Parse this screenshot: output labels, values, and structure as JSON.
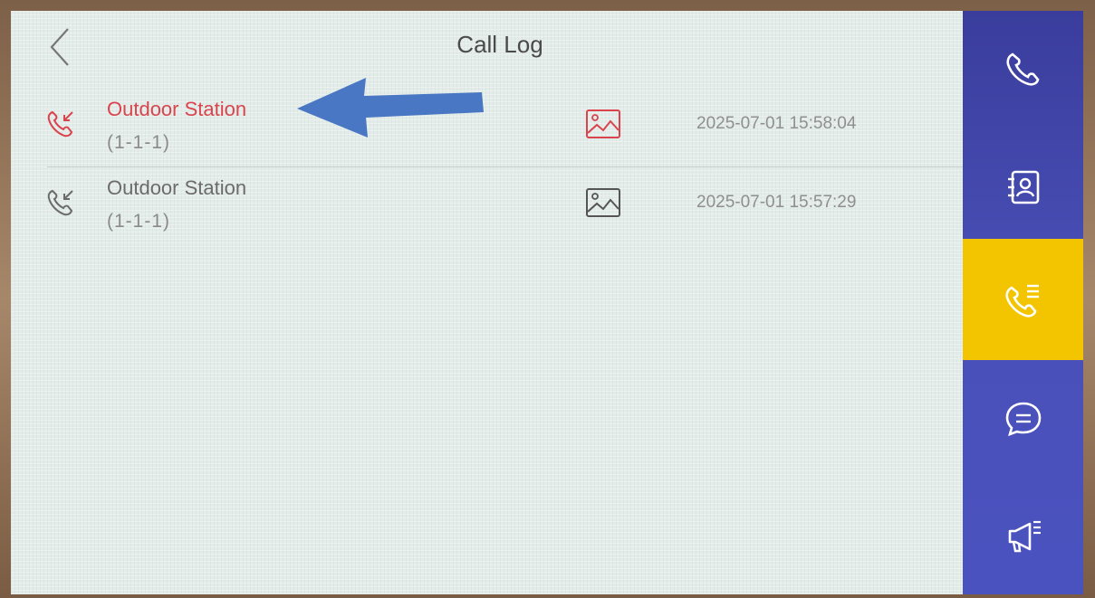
{
  "header": {
    "title": "Call Log",
    "back_icon": "chevron-left-icon"
  },
  "call_log": [
    {
      "name": "Outdoor Station",
      "number": "(1-1-1)",
      "time": "2025-07-01 15:58:04",
      "status": "missed",
      "call_icon": "missed-call-icon",
      "snapshot_icon": "image-icon"
    },
    {
      "name": "Outdoor Station",
      "number": "(1-1-1)",
      "time": "2025-07-01 15:57:29",
      "status": "incoming",
      "call_icon": "incoming-call-icon",
      "snapshot_icon": "image-icon"
    }
  ],
  "sidebar": {
    "items": [
      {
        "icon": "phone-icon",
        "active": false
      },
      {
        "icon": "contacts-icon",
        "active": false
      },
      {
        "icon": "call-log-icon",
        "active": true
      },
      {
        "icon": "message-icon",
        "active": false
      },
      {
        "icon": "announcement-icon",
        "active": false
      }
    ]
  },
  "colors": {
    "missed": "#d9444d",
    "sidebar": "#4a50b8",
    "sidebar_active": "#f2c500",
    "annotation_arrow": "#4a77c4"
  }
}
